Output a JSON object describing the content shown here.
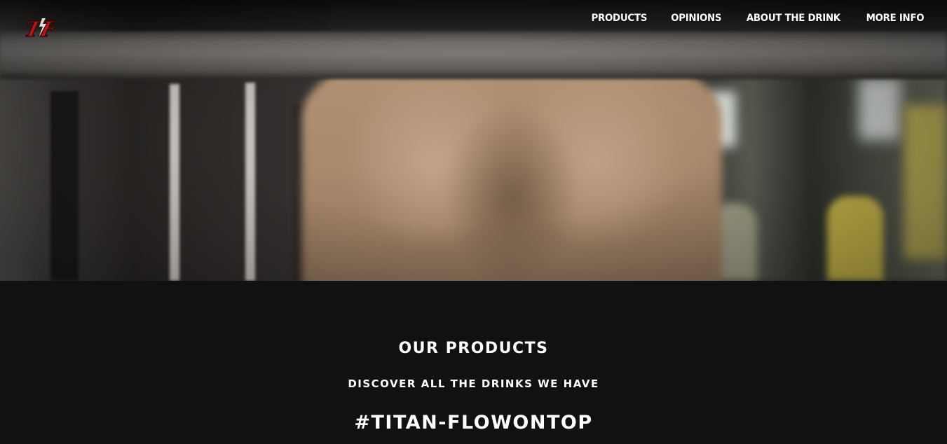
{
  "brand": {
    "logo_text": "TF",
    "logo_color": "#b01818"
  },
  "nav": {
    "items": [
      {
        "label": "PRODUCTS"
      },
      {
        "label": "OPINIONS"
      },
      {
        "label": "ABOUT THE DRINK"
      },
      {
        "label": "MORE INFO"
      }
    ]
  },
  "products_section": {
    "title": "OUR PRODUCTS",
    "subtitle": "DISCOVER ALL THE DRINKS WE HAVE",
    "hashtag": "#TITAN-FLOWONTOP"
  },
  "colors": {
    "page_background": "#121111",
    "text": "#ffffff",
    "accent": "#b01818"
  }
}
